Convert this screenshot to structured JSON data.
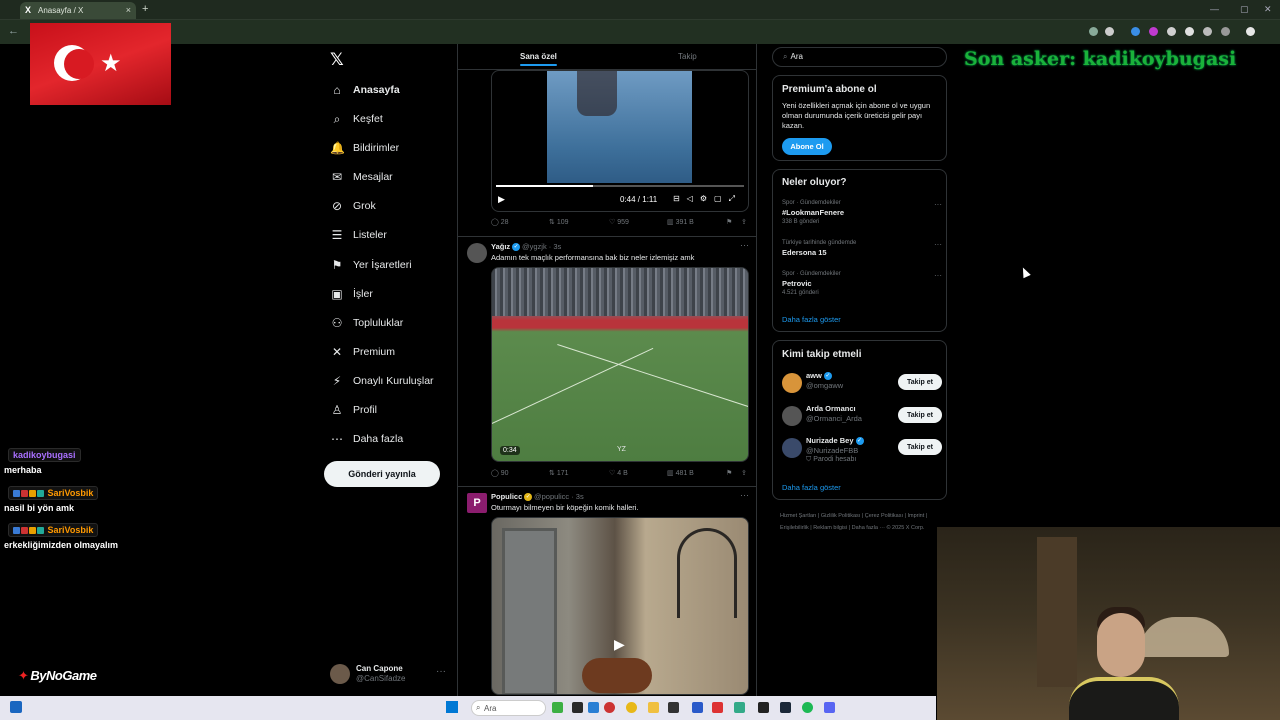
{
  "browser": {
    "tab_title": "Anasayfa / X",
    "tab_close": "×",
    "new_tab": "+",
    "back": "←"
  },
  "nav": {
    "logo": "𝕏",
    "items": [
      {
        "label": "Anasayfa",
        "icon": "⌂"
      },
      {
        "label": "Keşfet",
        "icon": "⌕"
      },
      {
        "label": "Bildirimler",
        "icon": "🔔"
      },
      {
        "label": "Mesajlar",
        "icon": "✉"
      },
      {
        "label": "Grok",
        "icon": "⊘"
      },
      {
        "label": "Listeler",
        "icon": "☰"
      },
      {
        "label": "Yer İşaretleri",
        "icon": "⚑"
      },
      {
        "label": "İşler",
        "icon": "▣"
      },
      {
        "label": "Topluluklar",
        "icon": "⚇"
      },
      {
        "label": "Premium",
        "icon": "✕"
      },
      {
        "label": "Onaylı Kuruluşlar",
        "icon": "⚡"
      },
      {
        "label": "Profil",
        "icon": "♙"
      },
      {
        "label": "Daha fazla",
        "icon": "⋯"
      }
    ],
    "post_button": "Gönderi yayınla",
    "account": {
      "name": "Can Capone",
      "handle": "@CanSifadze",
      "more": "···"
    }
  },
  "feed": {
    "tabs": {
      "for_you": "Sana özel",
      "following": "Takip"
    },
    "video1": {
      "time": "0:44 / 1:11",
      "play": "▶",
      "controls": "⊟◁⚙▢⤢"
    },
    "actions1": {
      "replies": "28",
      "reposts": "109",
      "likes": "959",
      "views": "391 B"
    },
    "tweet2": {
      "name": "Yağız",
      "handle": "@ygzjk · 3s",
      "text": "Adamın tek maçlık performansına bak biz neler izlemişiz amk",
      "duration": "0:34",
      "watermark": "YZ",
      "replies": "90",
      "reposts": "171",
      "likes": "4 B",
      "views": "481 B"
    },
    "tweet3": {
      "name": "Populicc",
      "handle": "@populicc · 3s",
      "text": "Oturmayı bilmeyen bir köpeğin komik halleri.",
      "avatar_letter": "P"
    }
  },
  "right": {
    "search_placeholder": "Ara",
    "premium": {
      "title": "Premium'a abone ol",
      "text": "Yeni özellikleri açmak için abone ol ve uygun olman durumunda içerik üreticisi gelir payı kazan.",
      "button": "Abone Ol"
    },
    "trends": {
      "title": "Neler oluyor?",
      "items": [
        {
          "category": "Spor · Gündemdekiler",
          "name": "#LookmanFenere",
          "count": "338 B gönderi"
        },
        {
          "category": "Türkiye tarihinde gündemde",
          "name": "Edersona 15",
          "count": ""
        },
        {
          "category": "Spor · Gündemdekiler",
          "name": "Petrovic",
          "count": "4.521 gönderi"
        }
      ],
      "show_more": "Daha fazla göster",
      "dots": "···"
    },
    "who_to_follow": {
      "title": "Kimi takip etmeli",
      "items": [
        {
          "name": "aww",
          "handle": "@omgaww",
          "extra": "",
          "button": "Takip et"
        },
        {
          "name": "Arda Ormancı",
          "handle": "@Ormanci_Arda",
          "extra": "",
          "button": "Takip et"
        },
        {
          "name": "Nurizade Bey",
          "handle": "@NurizadeFBB",
          "extra": "Parodi hesabı",
          "button": "Takip et"
        }
      ],
      "show_more": "Daha fazla göster"
    },
    "footer": "Hizmet Şartları  |  Gizlilik Politikası  |  Çerez Politikası  |  Imprint  |  Erişilebilirlik  |  Reklam bilgisi  |  Daha fazla ···  © 2025 X Corp."
  },
  "overlay": {
    "son_asker": "Son asker: kadikoybugasi",
    "chat": [
      {
        "user": "kadikoybugasi",
        "user_color": "#a970ff",
        "message": "merhaba"
      },
      {
        "user": "SariVosbik",
        "user_color": "#ff9900",
        "message": "nasil bi yön amk"
      },
      {
        "user": "SariVosbik",
        "user_color": "#ff9900",
        "message": "erkekliğimizden olmayalım"
      }
    ],
    "sponsor": "ByNoGame",
    "sponsor_mark": "✦"
  },
  "taskbar": {
    "search": "Ara"
  },
  "colors": {
    "accent": "#1d9bf0",
    "background": "#000000",
    "overlay_green": "#1ab23a"
  }
}
